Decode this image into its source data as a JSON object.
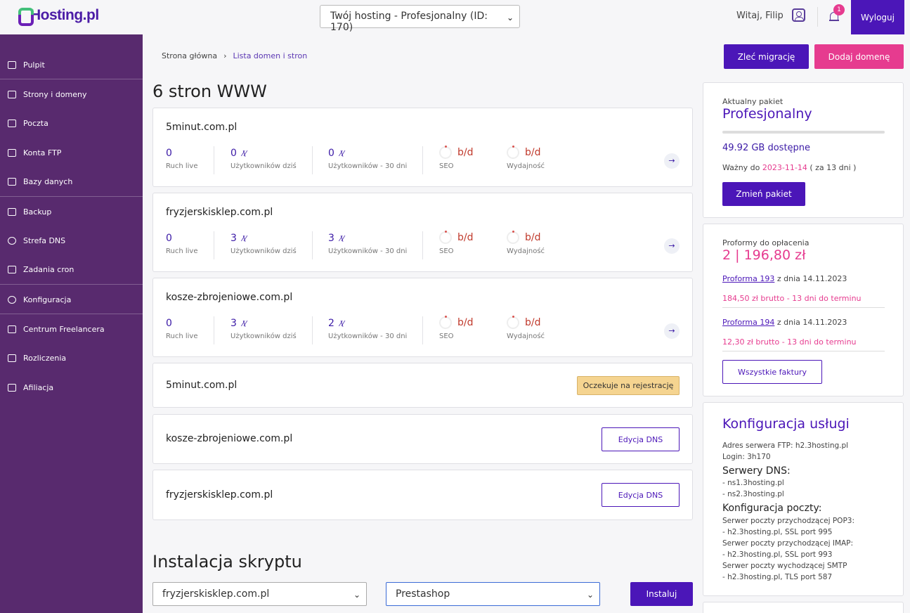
{
  "header": {
    "logo": "Hosting.pl",
    "hosting_select": "Twój hosting - Profesjonalny (ID: 170)",
    "greeting": "Witaj, Filip",
    "notifications": "1",
    "logout": "Wyloguj"
  },
  "sidebar": {
    "items": [
      {
        "label": "Pulpit"
      },
      {
        "label": "Strony i domeny"
      },
      {
        "label": "Poczta"
      },
      {
        "label": "Konta FTP"
      },
      {
        "label": "Bazy danych"
      },
      {
        "label": "Backup"
      },
      {
        "label": "Strefa DNS"
      },
      {
        "label": "Zadania cron"
      },
      {
        "label": "Konfiguracja"
      },
      {
        "label": "Centrum Freelancera"
      },
      {
        "label": "Rozliczenia"
      },
      {
        "label": "Afiliacja"
      }
    ]
  },
  "breadcrumb": {
    "home": "Strona główna",
    "current": "Lista domen i stron"
  },
  "actions": {
    "migrate": "Zleć migrację",
    "add_domain": "Dodaj domenę"
  },
  "main": {
    "title": "6 stron WWW",
    "stat_labels": {
      "live": "Ruch live",
      "today": "Użytkowników dziś",
      "month": "Użytkowników - 30 dni",
      "seo": "SEO",
      "perf": "Wydajność"
    },
    "sites": [
      {
        "domain": "5minut.com.pl",
        "live": "0",
        "today": "0",
        "month": "0",
        "seo": "b/d",
        "perf": "b/d"
      },
      {
        "domain": "fryzjerskisklep.com.pl",
        "live": "0",
        "today": "3",
        "month": "3",
        "seo": "b/d",
        "perf": "b/d"
      },
      {
        "domain": "kosze-zbrojeniowe.com.pl",
        "live": "0",
        "today": "3",
        "month": "2",
        "seo": "b/d",
        "perf": "b/d"
      }
    ],
    "domains": [
      {
        "domain": "5minut.com.pl",
        "status": "Oczekuje na rejestrację"
      },
      {
        "domain": "kosze-zbrojeniowe.com.pl",
        "action": "Edycja DNS"
      },
      {
        "domain": "fryzjerskisklep.com.pl",
        "action": "Edycja DNS"
      }
    ],
    "install": {
      "title": "Instalacja skryptu",
      "domain_select": "fryzjerskisklep.com.pl",
      "script_select": "Prestashop",
      "button": "Instaluj"
    }
  },
  "package": {
    "label": "Aktualny pakiet",
    "name": "Profesjonalny",
    "storage": "49.92 GB dostępne",
    "valid_prefix": "Ważny do",
    "valid_date": "2023-11-14",
    "valid_suffix": "( za 13 dni )",
    "button": "Zmień pakiet"
  },
  "invoices": {
    "label": "Proformy do opłacenia",
    "amount": "2 | 196,80 zł",
    "items": [
      {
        "link": "Proforma 193",
        "date": "z dnia 14.11.2023",
        "due": "184,50 zł brutto - 13 dni do terminu"
      },
      {
        "link": "Proforma 194",
        "date": "z dnia 14.11.2023",
        "due": "12,30 zł brutto - 13 dni do terminu"
      }
    ],
    "button": "Wszystkie faktury"
  },
  "config": {
    "title": "Konfiguracja usługi",
    "ftp": "Adres serwera FTP: h2.3hosting.pl",
    "login": "Login: 3h170",
    "dns_title": "Serwery DNS:",
    "dns1": "- ns1.3hosting.pl",
    "dns2": "- ns2.3hosting.pl",
    "mail_title": "Konfiguracja poczty:",
    "pop3_label": "Serwer poczty przychodzącej POP3:",
    "pop3": "- h2.3hosting.pl, SSL port 995",
    "imap_label": "Serwer poczty przychodzącej IMAP:",
    "imap": "- h2.3hosting.pl, SSL port 993",
    "smtp_label": "Serwer poczty wychodzącej SMTP",
    "smtp": "- h2.3hosting.pl, TLS port 587"
  },
  "colors": {
    "brand": "#4b16b8",
    "sidebar": "#582a6e",
    "accent": "#e63b8f"
  }
}
